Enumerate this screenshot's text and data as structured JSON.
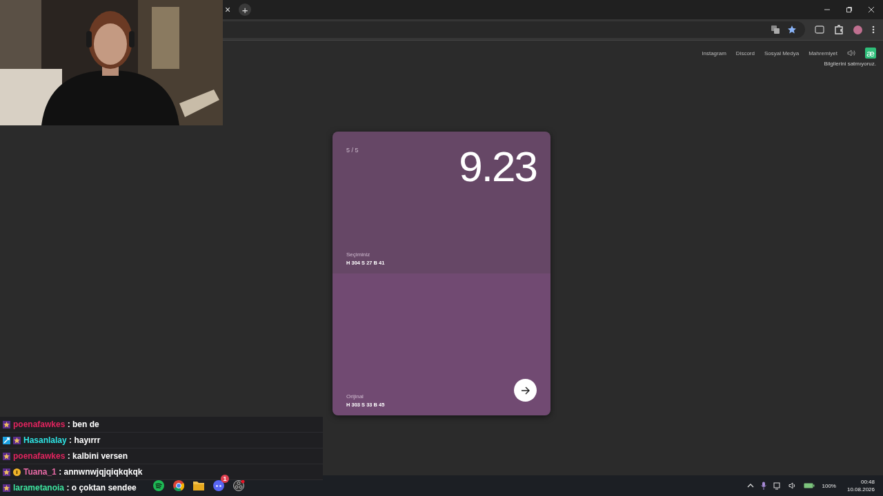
{
  "browser": {
    "tab_close": "×",
    "new_tab": "+"
  },
  "nav": {
    "links": [
      "Instagram",
      "Discord",
      "Sosyal Medya",
      "Mahremiyet"
    ],
    "logo": "æ",
    "note": "Bilgilerini satmıyoruz."
  },
  "card": {
    "progress": "5 / 5",
    "score": "9.23",
    "selection": {
      "label": "Seçiminiz",
      "value": "H 304 S 27 B 41",
      "color": "#664766"
    },
    "original": {
      "label": "Orijinal",
      "value": "H 303 S 33 B 45",
      "color": "#714a72"
    }
  },
  "chat": [
    {
      "user": "poenafawkes",
      "color": "#e0245e",
      "text": ": ben de",
      "badges": [
        {
          "kind": "sub"
        }
      ]
    },
    {
      "user": "Hasanlalay",
      "color": "#2ee6e6",
      "text": ": hayırrr",
      "badges": [
        {
          "kind": "mod"
        },
        {
          "kind": "sub"
        }
      ]
    },
    {
      "user": "poenafawkes",
      "color": "#e0245e",
      "text": ": kalbini versen",
      "badges": [
        {
          "kind": "sub"
        }
      ]
    },
    {
      "user": "Tuana_1",
      "color": "#e86aa6",
      "text": ": annwnwjqjqiqkqkqk",
      "badges": [
        {
          "kind": "sub"
        },
        {
          "kind": "bits"
        }
      ]
    },
    {
      "user": "larametanoia",
      "color": "#3ee6a0",
      "text": ": o çoktan sendee",
      "badges": [
        {
          "kind": "sub"
        }
      ]
    }
  ],
  "taskbar": {
    "discord_badge": "1",
    "battery": "100%",
    "time": "00:48",
    "date": "10.08.2026"
  }
}
